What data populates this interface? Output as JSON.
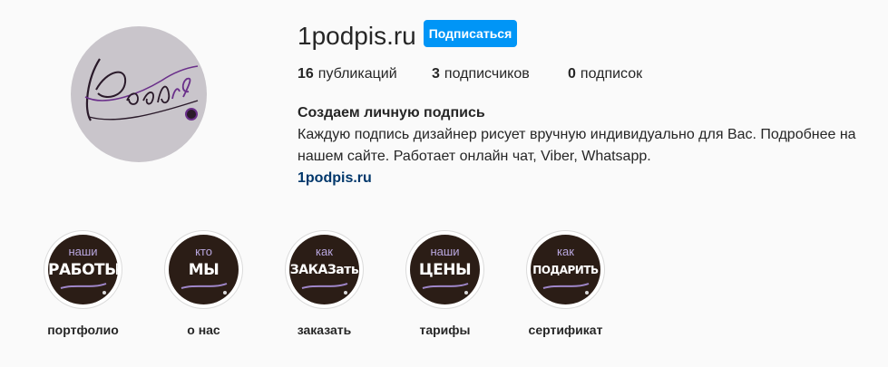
{
  "profile": {
    "username": "1podpis.ru",
    "follow_label": "Подписаться",
    "avatar_icon": "signature-logo-icon",
    "avatar_bg": "#c9c5cb",
    "accent": "#0095f6"
  },
  "stats": {
    "posts": {
      "count": "16",
      "label": "публикаций"
    },
    "followers": {
      "count": "3",
      "label": "подписчиков"
    },
    "following": {
      "count": "0",
      "label": "подписок"
    }
  },
  "bio": {
    "name": "Создаем личную подпись",
    "text": "Каждую подпись дизайнер рисует вручную индивидуально для Вас. Подробнее на нашем сайте. Работает онлайн чат, Viber, Whatsapp.",
    "link": "1podpis.ru"
  },
  "highlights": [
    {
      "top": "наши",
      "big": "РАБОТЫ",
      "label": "портфолио"
    },
    {
      "top": "кто",
      "big": "МЫ",
      "label": "о нас"
    },
    {
      "top": "как",
      "big": "ЗАКАЗать",
      "label": "заказать"
    },
    {
      "top": "наши",
      "big": "ЦЕНЫ",
      "label": "тарифы"
    },
    {
      "top": "как",
      "big": "ПОДАРИТЬ",
      "label": "сертификат"
    }
  ]
}
